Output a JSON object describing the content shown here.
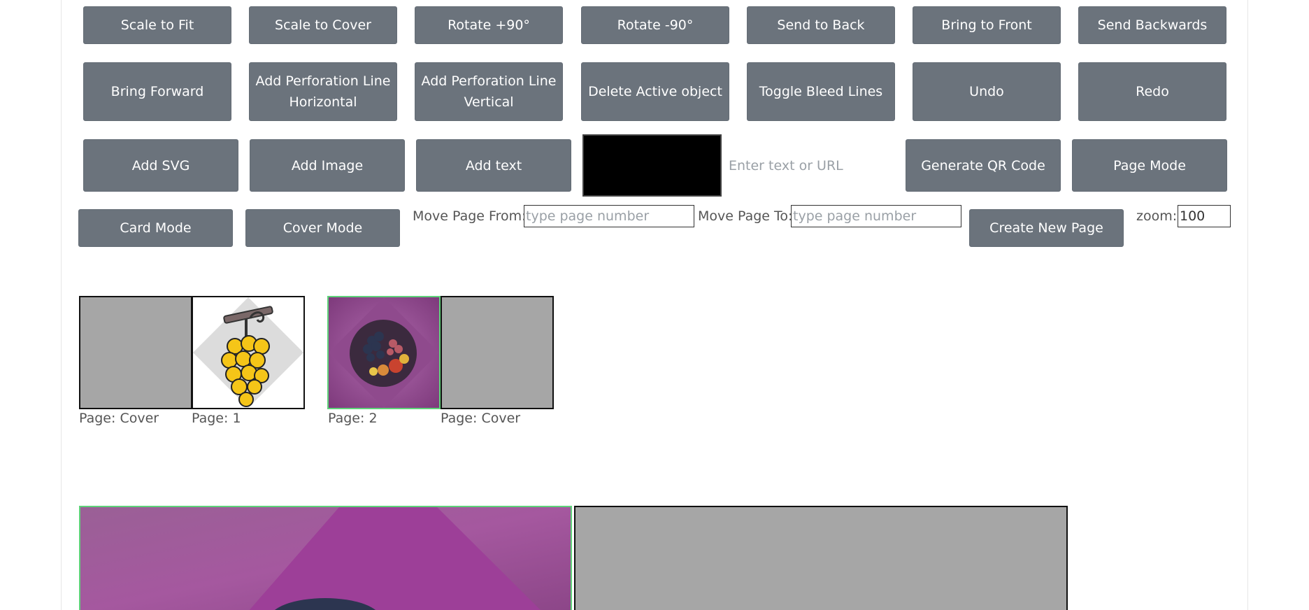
{
  "toolbar": {
    "row1": [
      "Scale to Fit",
      "Scale to Cover",
      "Rotate +90°",
      "Rotate -90°",
      "Send to Back",
      "Bring to Front",
      "Send Backwards"
    ],
    "row2": [
      "Bring Forward",
      "Add Perforation Line Horizontal",
      "Add Perforation Line Vertical",
      "Delete Active object",
      "Toggle Bleed Lines",
      "Undo",
      "Redo"
    ],
    "row3": {
      "add_svg": "Add SVG",
      "add_image": "Add Image",
      "add_text": "Add text",
      "color_value": "#000000",
      "qr_placeholder": "Enter text or URL",
      "generate_qr": "Generate QR Code",
      "page_mode": "Page Mode"
    },
    "row4": {
      "card_mode": "Card Mode",
      "cover_mode": "Cover Mode",
      "move_from_label": "Move Page From:",
      "move_from_placeholder": "type page number",
      "move_to_label": "Move Page To:",
      "move_to_placeholder": "type page number",
      "create_page": "Create New Page",
      "zoom_label": "zoom:",
      "zoom_value": "100"
    }
  },
  "thumbnails": [
    {
      "caption": "Page: Cover",
      "content": "blank",
      "active": false
    },
    {
      "caption": "Page: 1",
      "content": "grapes-icon",
      "active": false
    },
    {
      "caption": "Page: 2",
      "content": "fruit-plate-photo",
      "active": true
    },
    {
      "caption": "Page: Cover",
      "content": "blank",
      "active": false
    }
  ],
  "colors": {
    "button_bg": "#6b737c",
    "page_blank": "#a6a6a6",
    "active_border": "#5fd27a",
    "purple_bg": "#9a4f97"
  }
}
